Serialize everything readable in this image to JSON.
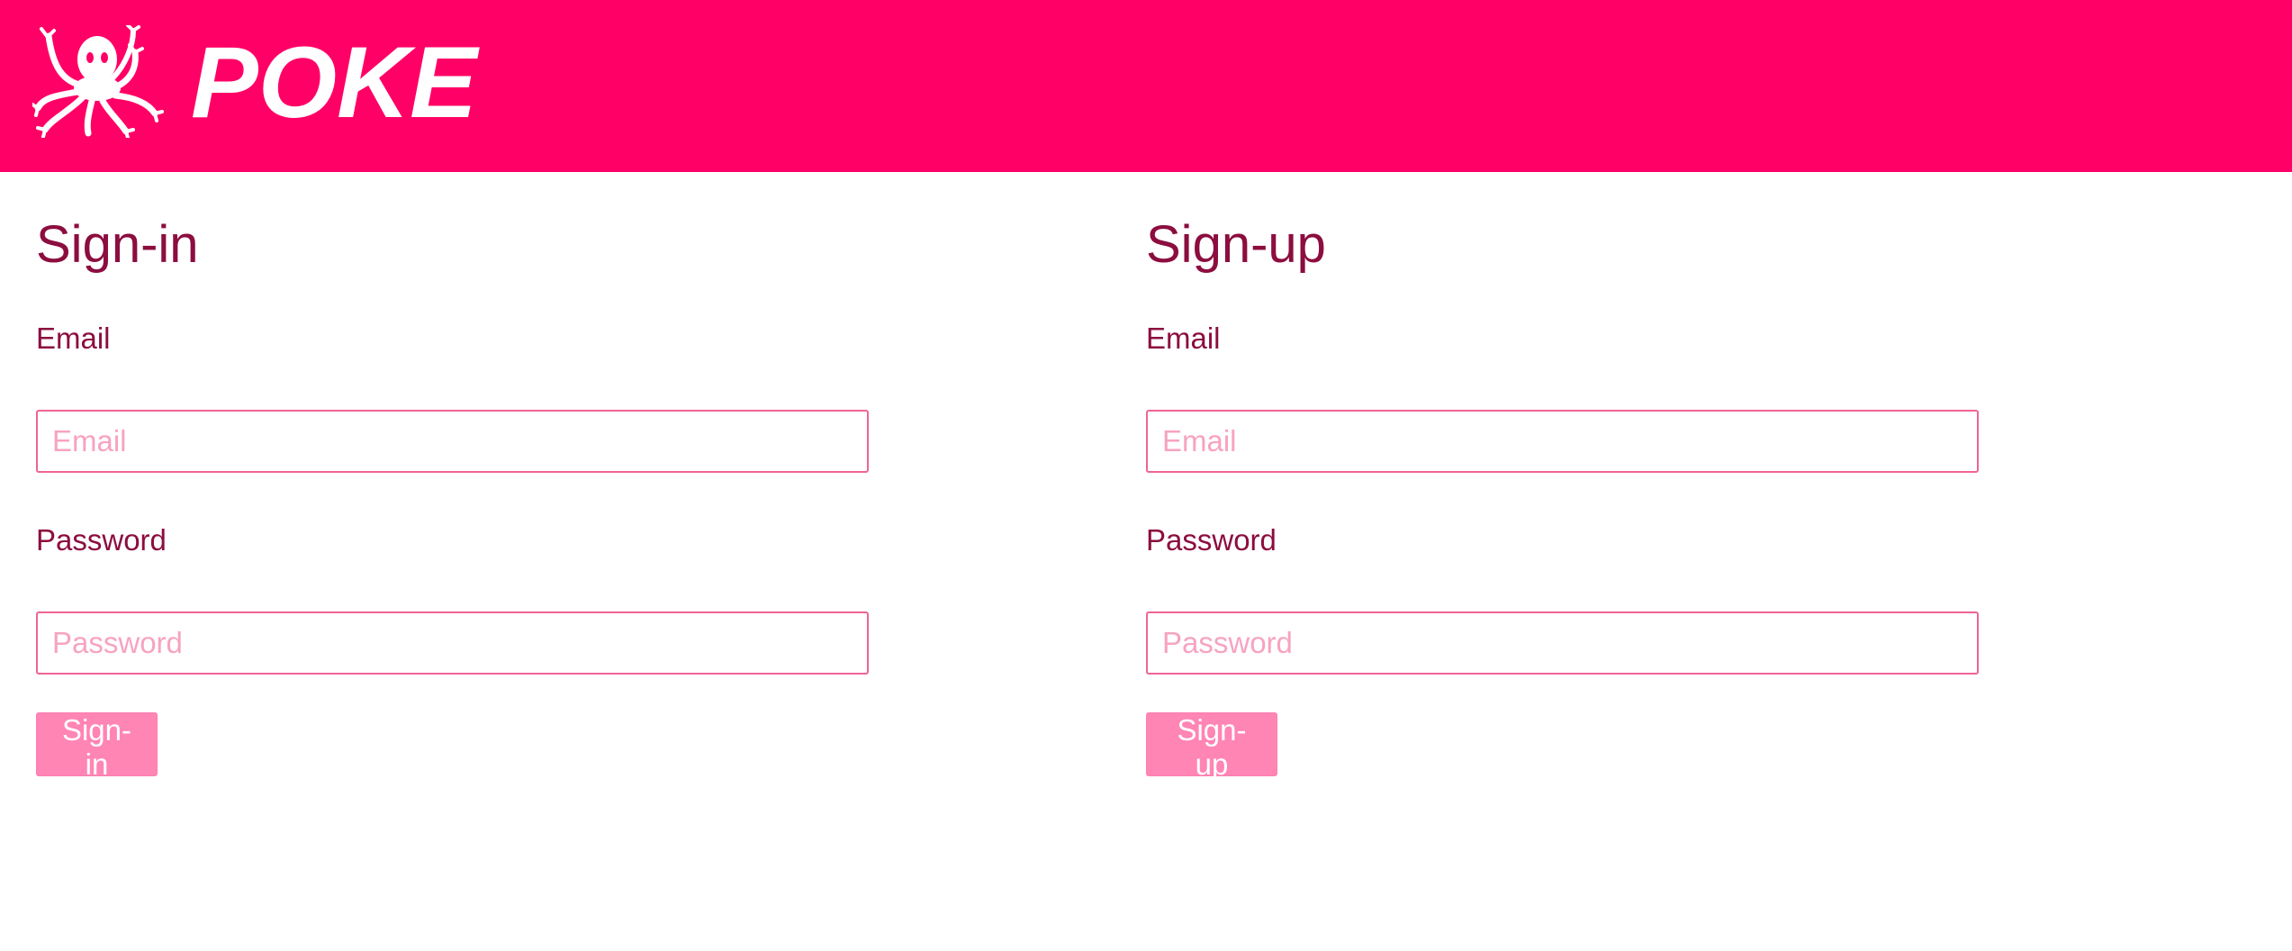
{
  "brand": {
    "logo_text": "POKE",
    "header_color": "#ff0066",
    "mascot_icon": "octopus-icon"
  },
  "signin": {
    "title": "Sign-in",
    "email_label": "Email",
    "email_placeholder": "Email",
    "password_label": "Password",
    "password_placeholder": "Password",
    "button_label": "Sign-in"
  },
  "signup": {
    "title": "Sign-up",
    "email_label": "Email",
    "email_placeholder": "Email",
    "password_label": "Password",
    "password_placeholder": "Password",
    "button_label": "Sign-up"
  },
  "colors": {
    "accent": "#ff0066",
    "text": "#8c0d3f",
    "input_border": "#f06497",
    "placeholder": "#f7a3c2",
    "button": "#ff85b5"
  }
}
